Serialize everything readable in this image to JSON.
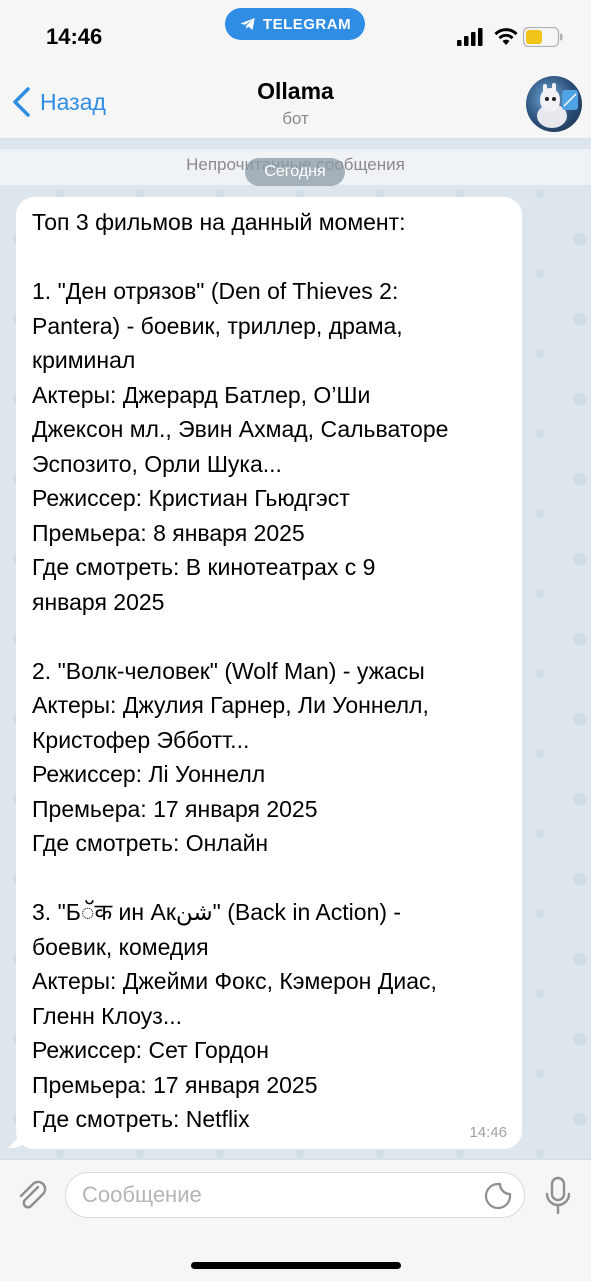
{
  "status_bar": {
    "time": "14:46",
    "app_pill": "TELEGRAM"
  },
  "header": {
    "back_label": "Назад",
    "title": "Ollama",
    "subtitle": "бот"
  },
  "chat": {
    "unread_banner": "Непрочитанные сообщения",
    "date_pill": "Сегодня",
    "message": {
      "lines": [
        "Топ 3 фильмов на данный момент:",
        "",
        "1. \"Ден отрязов\" (Den of Thieves 2:",
        "Pantera) - боевик, триллер, драма,",
        "криминал",
        "Актеры: Джерард Батлер, О’Ши",
        "Джексон мл., Эвин Ахмад, Сальваторе",
        "Эспозито, Орли Шука...",
        "Режиссер: Кристиан Гьюдгэст",
        "Премьера: 8 января 2025",
        "Где смотреть: В кинотеатрах с 9",
        "января 2025",
        "",
        "2. \"Волк-человек\" (Wolf Man) - ужасы",
        "Актеры: Джулия Гарнер, Ли Уоннелл,",
        "Кристофер Эбботт...",
        "Режиссер: Лі Уоннелл",
        "Премьера: 17 января 2025",
        "Где смотреть: Онлайн",
        "",
        "3. \"Бॅक ин Акشن\" (Back in Action) -",
        "боевик, комедия",
        "Актеры: Джейми Фокс, Кэмерон Диас,",
        "Гленн Клоуз...",
        "Режиссер: Сет Гордон",
        "Премьера: 17 января 2025",
        "Где смотреть: Netflix"
      ],
      "time": "14:46"
    }
  },
  "input": {
    "placeholder": "Сообщение"
  },
  "icons": {
    "back": "chevron-left-icon",
    "attach": "paperclip-icon",
    "sticker": "sticker-icon",
    "mic": "microphone-icon"
  },
  "colors": {
    "accent": "#2f8de4",
    "chat_background": "#dde6ed",
    "bubble": "#ffffff"
  }
}
